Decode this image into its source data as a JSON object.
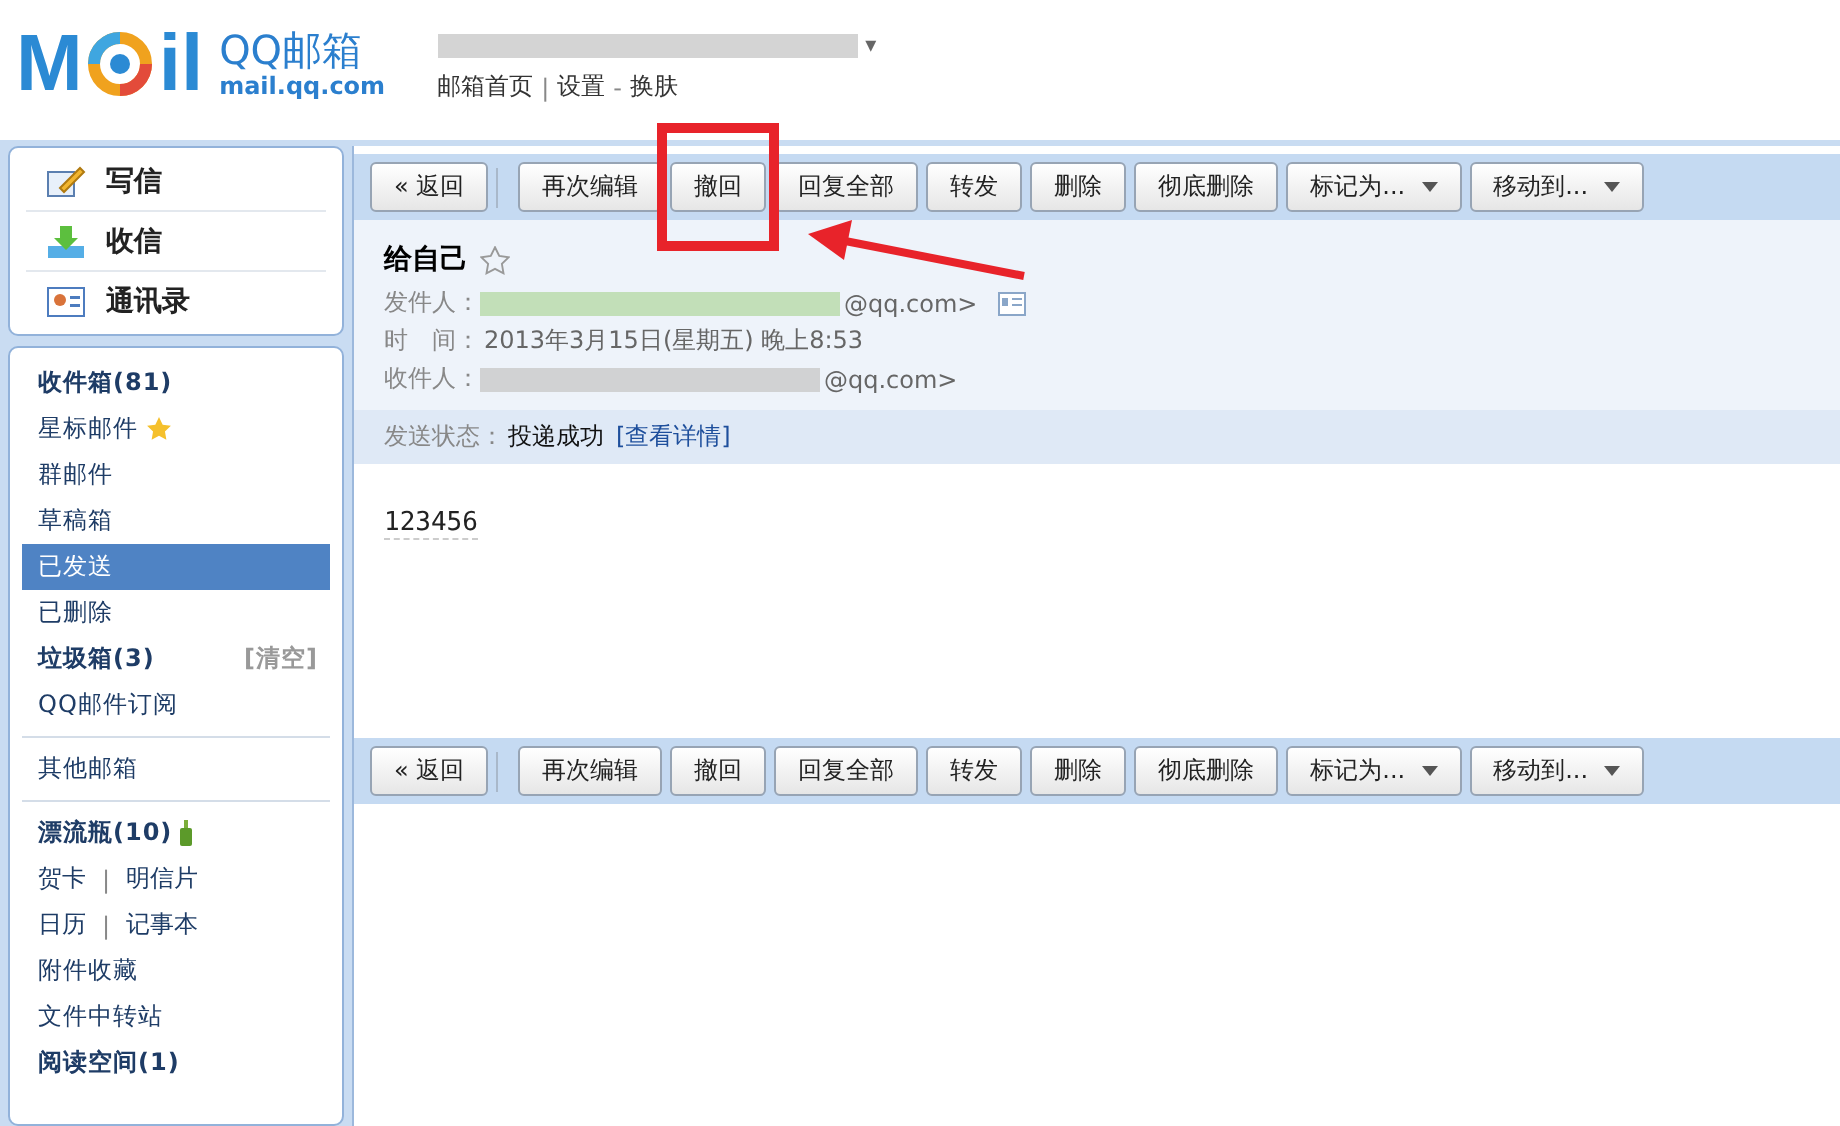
{
  "header": {
    "logo_letters": [
      "M",
      "il"
    ],
    "brand": "QQ邮箱",
    "domain": "mail.qq.com",
    "account_suffix": "▾",
    "links": [
      {
        "label": "邮箱首页"
      },
      {
        "sep": "|",
        "label": "设置"
      },
      {
        "sep": "-",
        "label": "换肤"
      }
    ]
  },
  "quick_actions": [
    {
      "kind": "compose",
      "label": "写信"
    },
    {
      "kind": "receive",
      "label": "收信"
    },
    {
      "kind": "contacts",
      "label": "通讯录"
    }
  ],
  "folder_groups": [
    [
      {
        "kind": "folder",
        "label": "收件箱(81)",
        "bold": true,
        "selected": false
      },
      {
        "kind": "starred",
        "label": "星标邮件",
        "bold": false,
        "selected": false
      },
      {
        "kind": "folder",
        "label": "群邮件",
        "bold": false,
        "selected": false
      },
      {
        "kind": "folder",
        "label": "草稿箱",
        "bold": false,
        "selected": false
      },
      {
        "kind": "folder",
        "label": "已发送",
        "bold": false,
        "selected": true
      },
      {
        "kind": "folder",
        "label": "已删除",
        "bold": false,
        "selected": false
      },
      {
        "kind": "trash",
        "label": "垃圾箱(3)",
        "bold": true,
        "selected": false,
        "action": "[清空]"
      },
      {
        "kind": "folder",
        "label": "QQ邮件订阅",
        "bold": false,
        "selected": false
      }
    ],
    [
      {
        "kind": "folder",
        "label": "其他邮箱",
        "bold": false,
        "selected": false
      }
    ],
    [
      {
        "kind": "bottle",
        "label": "漂流瓶(10)",
        "bold": true,
        "selected": false
      },
      {
        "kind": "pair",
        "labels": [
          "贺卡",
          "明信片"
        ],
        "sep": "|"
      },
      {
        "kind": "pair",
        "labels": [
          "日历",
          "记事本"
        ],
        "sep": "|"
      },
      {
        "kind": "folder",
        "label": "附件收藏",
        "bold": false,
        "selected": false
      },
      {
        "kind": "folder",
        "label": "文件中转站",
        "bold": false,
        "selected": false
      },
      {
        "kind": "folder",
        "label": "阅读空间(1)",
        "bold": true,
        "selected": false
      }
    ]
  ],
  "toolbar_top": [
    {
      "label": "« 返回",
      "dropdown": false
    },
    {
      "label": "再次编辑",
      "dropdown": false
    },
    {
      "label": "撤回",
      "dropdown": false
    },
    {
      "label": "回复全部",
      "dropdown": false
    },
    {
      "label": "转发",
      "dropdown": false
    },
    {
      "label": "删除",
      "dropdown": false
    },
    {
      "label": "彻底删除",
      "dropdown": false
    },
    {
      "label": "标记为...",
      "dropdown": true
    },
    {
      "label": "移动到...",
      "dropdown": true
    }
  ],
  "message": {
    "subject": "给自己",
    "starred": false,
    "fields": [
      {
        "label": "发件人：",
        "value": "@qq.com>",
        "redacted": true,
        "card": true
      },
      {
        "label": "时　间：",
        "value": "2013年3月15日(星期五) 晚上8:53",
        "redacted": false
      },
      {
        "label": "收件人：",
        "value": "@qq.com>",
        "redacted": true
      }
    ],
    "status": {
      "label": "发送状态：",
      "value": "投递成功",
      "link": "[查看详情]"
    },
    "body": "123456"
  },
  "toolbar_bottom": [
    {
      "label": "« 返回",
      "dropdown": false
    },
    {
      "label": "再次编辑",
      "dropdown": false
    },
    {
      "label": "撤回",
      "dropdown": false
    },
    {
      "label": "回复全部",
      "dropdown": false
    },
    {
      "label": "转发",
      "dropdown": false
    },
    {
      "label": "删除",
      "dropdown": false
    },
    {
      "label": "彻底删除",
      "dropdown": false
    },
    {
      "label": "标记为...",
      "dropdown": true
    },
    {
      "label": "移动到...",
      "dropdown": true
    }
  ]
}
